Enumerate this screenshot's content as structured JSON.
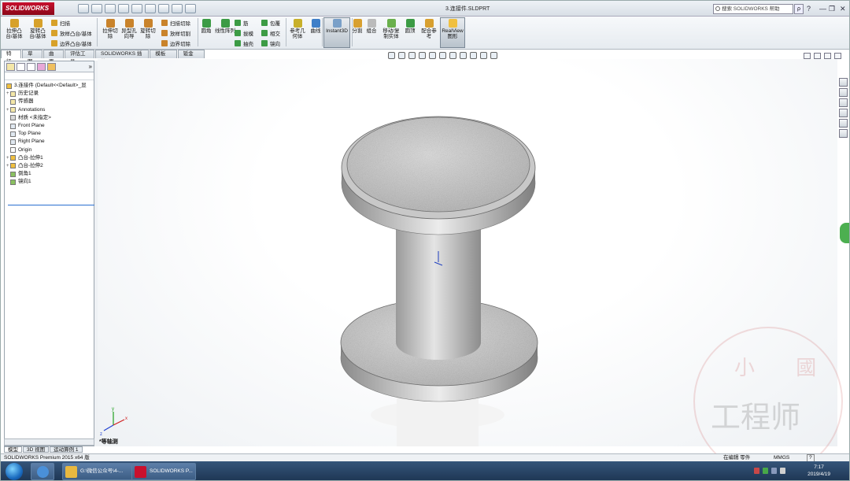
{
  "app": {
    "logo": "SOLIDWORKS",
    "document_title": "3.连接件.SLDPRT",
    "search_placeholder": "搜索 SOLIDWORKS 帮助",
    "search_btn": "ρ",
    "help": "?",
    "minimize": "—",
    "restore": "❐",
    "close": "✕"
  },
  "ribbon": {
    "large": [
      {
        "label": "拉伸凸台/基体",
        "color": "#d7a12a"
      },
      {
        "label": "旋转凸台/基体",
        "color": "#d7a12a"
      },
      {
        "label": "拉伸切除",
        "color": "#c9832b"
      },
      {
        "label": "异型孔向导",
        "color": "#c9832b"
      },
      {
        "label": "旋转切除",
        "color": "#c9832b"
      },
      {
        "label": "圆角",
        "color": "#3c9b45"
      },
      {
        "label": "线性阵列",
        "color": "#3c9b45"
      },
      {
        "label": "参考几何体",
        "color": "#c8b02a"
      },
      {
        "label": "曲线",
        "color": "#3f7fc8"
      },
      {
        "label": "Instant3D",
        "color": "#7aa0c8"
      },
      {
        "label": "分割",
        "color": "#d8a030"
      },
      {
        "label": "组合",
        "color": "#bbbbbb"
      },
      {
        "label": "移动/复制实体",
        "color": "#6ab04c"
      },
      {
        "label": "圆顶",
        "color": "#3c9b45"
      },
      {
        "label": "配合参考",
        "color": "#d8a030"
      },
      {
        "label": "RealView 图形",
        "color": "#f0c040"
      }
    ],
    "small": [
      {
        "label": "扫描",
        "color": "#d7a12a"
      },
      {
        "label": "放样凸台/基体",
        "color": "#d7a12a"
      },
      {
        "label": "边界凸台/基体",
        "color": "#d7a12a"
      },
      {
        "label": "扫描切除",
        "color": "#c9832b"
      },
      {
        "label": "放样切割",
        "color": "#c9832b"
      },
      {
        "label": "边界切除",
        "color": "#c9832b"
      },
      {
        "label": "筋",
        "color": "#3c9b45"
      },
      {
        "label": "拔模",
        "color": "#3c9b45"
      },
      {
        "label": "抽壳",
        "color": "#3c9b45"
      },
      {
        "label": "包覆",
        "color": "#3c9b45"
      },
      {
        "label": "相交",
        "color": "#3c9b45"
      },
      {
        "label": "镜向",
        "color": "#3c9b45"
      }
    ]
  },
  "command_tabs": [
    "特征",
    "草图",
    "曲面",
    "评估工具",
    "SOLIDWORKS 插件",
    "模板(D)",
    "钣金(H)"
  ],
  "feature_tree": {
    "root": "3.连接件  (Default<<Default>_显",
    "items": [
      {
        "label": "历史记录",
        "color": "#f4e7a8",
        "pm": "+"
      },
      {
        "label": "传感器",
        "color": "#f4e7a8",
        "pm": ""
      },
      {
        "label": "Annotations",
        "color": "#f4e7a8",
        "pm": "+"
      },
      {
        "label": "材质 <未指定>",
        "color": "#d8d8d8",
        "pm": ""
      },
      {
        "label": "Front Plane",
        "color": "#e0e8f0",
        "pm": ""
      },
      {
        "label": "Top Plane",
        "color": "#e0e8f0",
        "pm": ""
      },
      {
        "label": "Right Plane",
        "color": "#e0e8f0",
        "pm": ""
      },
      {
        "label": "Origin",
        "color": "#ffffff",
        "pm": ""
      },
      {
        "label": "凸台-拉伸1",
        "color": "#f0c040",
        "pm": "+"
      },
      {
        "label": "凸台-拉伸2",
        "color": "#f0c040",
        "pm": "+"
      },
      {
        "label": "倒角1",
        "color": "#8ac060",
        "pm": ""
      },
      {
        "label": "镜向1",
        "color": "#8ac060",
        "pm": ""
      }
    ]
  },
  "bottom_tabs": [
    "模型",
    "3D 视图",
    "运动算例 1"
  ],
  "viewport": {
    "view_label": "*等轴测",
    "axis_x": "x",
    "axis_y": "y",
    "axis_z": "z"
  },
  "status": {
    "left": "SOLIDWORKS Premium 2015 x64 版",
    "mode": "在编辑 零件",
    "units": "MMGS",
    "help": "?"
  },
  "taskbar": {
    "items": [
      {
        "label": "G:\\微信公众号\\4-...",
        "color": "#e8b840"
      },
      {
        "label": "SOLIDWORKS P...",
        "color": "#c8102e"
      }
    ],
    "time": "7:17",
    "date": "2019/4/19"
  },
  "watermark": {
    "top": "小 國",
    "main": "工程师"
  }
}
